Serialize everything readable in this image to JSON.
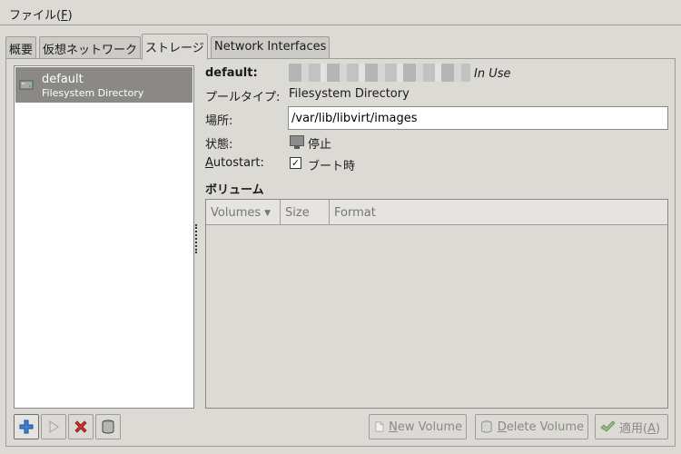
{
  "menubar": {
    "file_label_prefix": "ファイル(",
    "file_mnemonic": "F",
    "file_label_suffix": ")"
  },
  "tabs": [
    {
      "label": "概要"
    },
    {
      "label": "仮想ネットワーク"
    },
    {
      "label": "ストレージ"
    },
    {
      "label": "Network Interfaces"
    }
  ],
  "pools": [
    {
      "name": "default",
      "type": "Filesystem Directory"
    }
  ],
  "details": {
    "name": "default:",
    "in_use": "In Use",
    "pool_type_label": "プールタイプ:",
    "pool_type_value": "Filesystem Directory",
    "location_label": "場所:",
    "location_value": "/var/lib/libvirt/images",
    "state_label": "状態:",
    "state_value": "停止",
    "autostart_label_mn": "A",
    "autostart_label_rest": "utostart:",
    "autostart_check": "✓",
    "autostart_value": "ブート時"
  },
  "volumes": {
    "heading": "ボリューム",
    "columns": [
      "Volumes",
      "Size",
      "Format"
    ],
    "sort_indicator": "▼",
    "rows": []
  },
  "buttons": {
    "new_volume_mn": "N",
    "new_volume_rest": "ew Volume",
    "delete_volume_mn": "D",
    "delete_volume_rest": "elete Volume",
    "apply_prefix": "適用(",
    "apply_mn": "A",
    "apply_suffix": ")"
  },
  "colors": {
    "add": "#3f7fd0",
    "delete": "#c8342a",
    "apply": "#4aa52e"
  }
}
